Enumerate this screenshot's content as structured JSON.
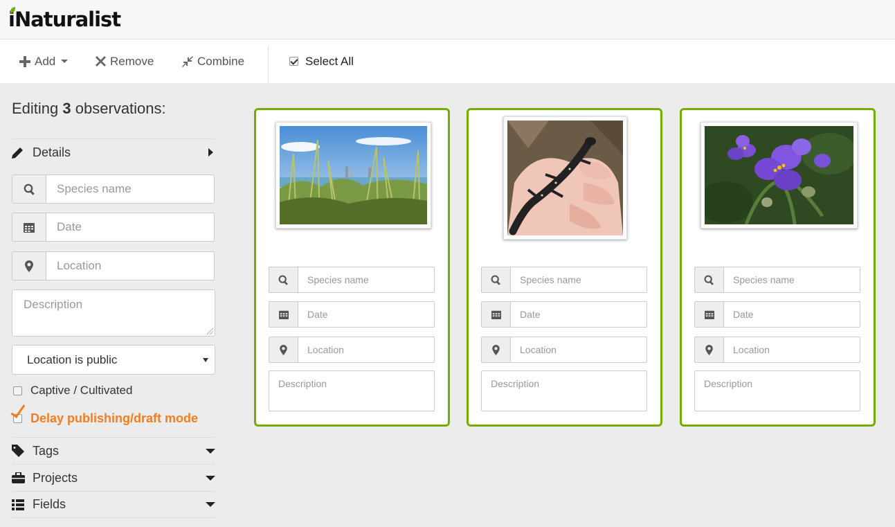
{
  "header": {
    "logo_text": "iNaturalist",
    "brand_color": "#74ac00"
  },
  "toolbar": {
    "add_label": "Add",
    "remove_label": "Remove",
    "combine_label": "Combine",
    "select_all_label": "Select All",
    "select_all_checked": true
  },
  "sidebar": {
    "editing_prefix": "Editing",
    "editing_count": "3",
    "editing_suffix": "observations:",
    "details_label": "Details",
    "species_placeholder": "Species name",
    "date_placeholder": "Date",
    "location_placeholder": "Location",
    "description_placeholder": "Description",
    "geoprivacy_value": "Location is public",
    "captive_label": "Captive / Cultivated",
    "captive_checked": false,
    "delay_label": "Delay publishing/draft mode",
    "delay_color": "#f47d20",
    "tags_label": "Tags",
    "projects_label": "Projects",
    "fields_label": "Fields"
  },
  "cards": [
    {
      "photo_subject": "tall grass by water with city skyline",
      "species_placeholder": "Species name",
      "date_placeholder": "Date",
      "location_placeholder": "Location",
      "description_placeholder": "Description"
    },
    {
      "photo_subject": "dark spotted salamander on a hand",
      "species_placeholder": "Species name",
      "date_placeholder": "Date",
      "location_placeholder": "Location",
      "description_placeholder": "Description"
    },
    {
      "photo_subject": "purple spiderwort flowers",
      "species_placeholder": "Species name",
      "date_placeholder": "Date",
      "location_placeholder": "Location",
      "description_placeholder": "Description"
    }
  ],
  "icons": {
    "add": "plus-icon",
    "remove": "x-icon",
    "combine": "compress-icon",
    "search": "search-icon",
    "date": "calendar-icon",
    "location": "map-marker-icon",
    "details": "pencil-icon",
    "tags": "tag-icon",
    "projects": "briefcase-icon",
    "fields": "list-icon"
  },
  "colors": {
    "card_border": "#74ac00",
    "page_bg": "#ececec"
  }
}
